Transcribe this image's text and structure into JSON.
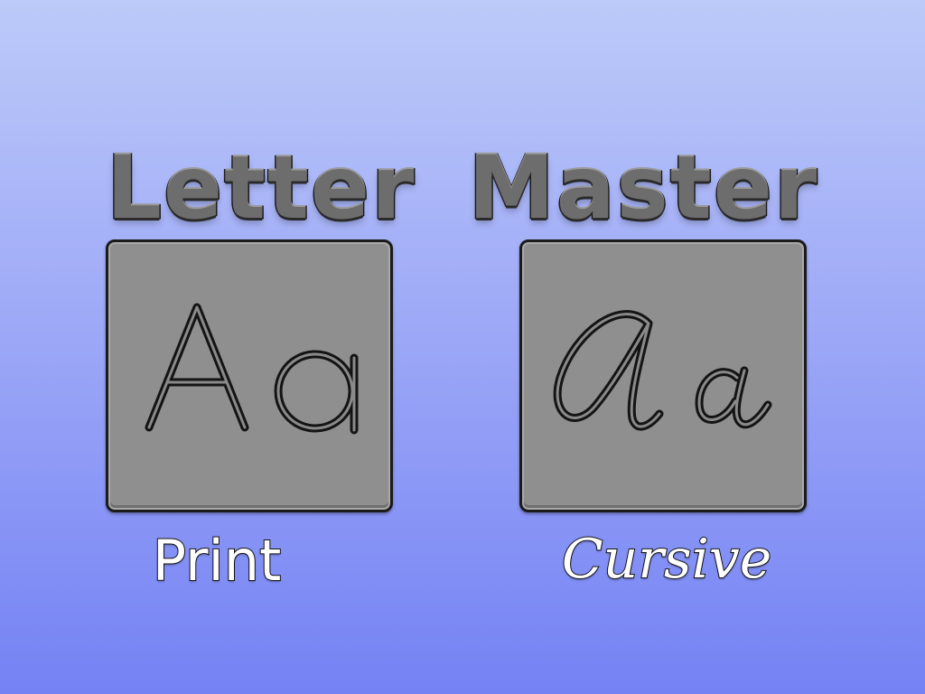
{
  "title": {
    "word1": "Letter",
    "word2": "Master"
  },
  "modes": {
    "print": {
      "label": "Print",
      "sample": "Aa"
    },
    "cursive": {
      "label": "Cursive",
      "sample": "Aa"
    }
  },
  "colors": {
    "background_top": "#bccaf9",
    "background_bottom": "#7482f4",
    "tile_fill": "#8f8f8f",
    "title_fill": "#6d6d6d",
    "outline": "#141414",
    "caption_fill": "#ffffff"
  }
}
